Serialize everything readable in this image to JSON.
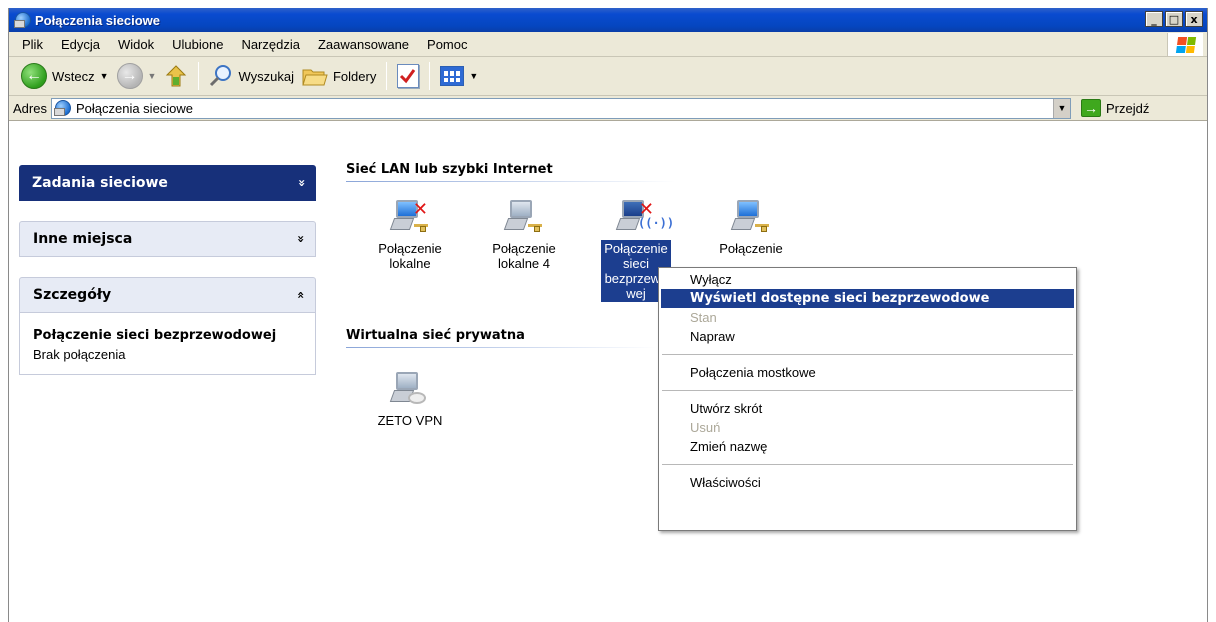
{
  "window": {
    "title": "Połączenia sieciowe",
    "minimize": "_",
    "maximize": "□",
    "close": "x"
  },
  "menubar": [
    "Plik",
    "Edycja",
    "Widok",
    "Ulubione",
    "Narzędzia",
    "Zaawansowane",
    "Pomoc"
  ],
  "toolbar": {
    "back": "Wstecz",
    "search": "Wyszukaj",
    "folders": "Foldery"
  },
  "address": {
    "label": "Adres",
    "value": "Połączenia sieciowe",
    "go": "Przejdź"
  },
  "sidebar": {
    "tasks": "Zadania sieciowe",
    "other": "Inne miejsca",
    "details": "Szczegóły",
    "chevron_down": "»",
    "chevron_up": "«",
    "detail_title": "Połączenie sieci bezprzewodowej",
    "detail_status": "Brak połączenia"
  },
  "groups": {
    "lan": "Sieć LAN lub szybki Internet",
    "vpn": "Wirtualna sieć prywatna"
  },
  "items": {
    "lan1": "Połączenie lokalne",
    "lan4": "Połączenie lokalne 4",
    "wireless": "Połączenie sieci bezprzewo wej",
    "other": "Połączenie",
    "vpn": "ZETO VPN"
  },
  "context_menu": {
    "disable": "Wyłącz",
    "view_wireless": "Wyświetl dostępne sieci bezprzewodowe",
    "status": "Stan",
    "repair": "Napraw",
    "bridge": "Połączenia mostkowe",
    "shortcut": "Utwórz skrót",
    "delete": "Usuń",
    "rename": "Zmień nazwę",
    "properties": "Właściwości"
  },
  "icons": {
    "back": "back-arrow-icon",
    "forward": "forward-arrow-icon",
    "up": "up-folder-icon",
    "search": "search-icon",
    "folders": "folders-icon",
    "views": "views-icon",
    "go": "go-arrow-icon"
  }
}
